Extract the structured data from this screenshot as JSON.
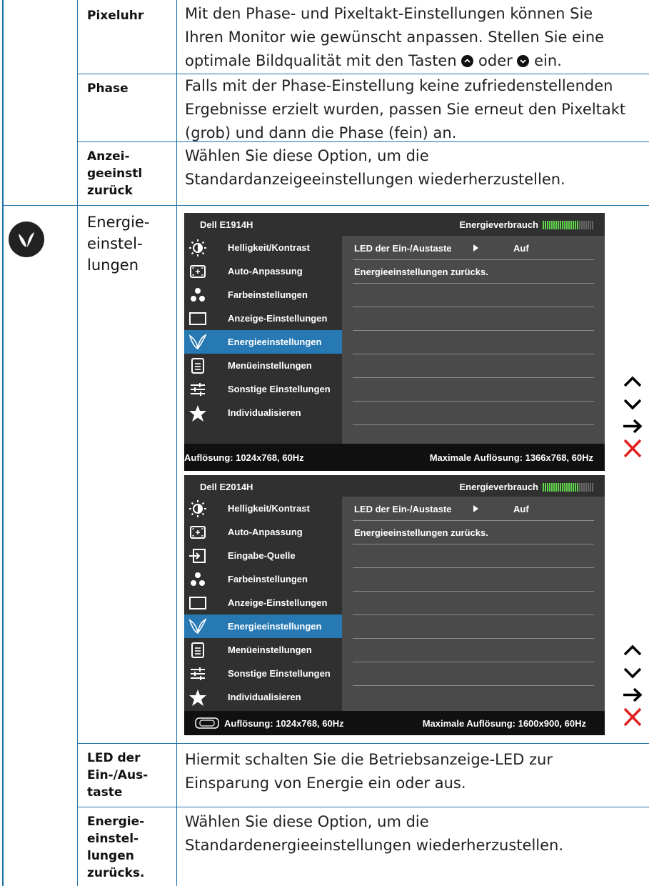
{
  "rows": {
    "pixeluhr": {
      "label": "Pixeluhr",
      "desc_line1": "Mit den Phase- und Pixeltakt-Einstellungen können Sie",
      "desc_line2": "Ihren Monitor wie gewünscht anpassen. Stellen Sie eine",
      "desc_line3a": "optimale Bildqualität mit den Tasten",
      "desc_line3b": "oder",
      "desc_line3c": "ein."
    },
    "phase": {
      "label": "Phase",
      "desc_line1": "Falls mit der Phase-Einstellung keine zufriedenstellenden",
      "desc_line2": "Ergebnisse erzielt wurden, passen Sie erneut den Pixeltakt",
      "desc_line3": "(grob) und dann die Phase (fein) an."
    },
    "anzeige_reset": {
      "label_line1": "Anzei-",
      "label_line2": "geeinstl",
      "label_line3": "zurück",
      "desc_line1": "Wählen Sie diese Option, um die",
      "desc_line2": "Standardanzeigeeinstellungen wiederherzustellen."
    },
    "energie": {
      "label_line1": "Energie-",
      "label_line2": "einstel-",
      "label_line3": "lungen"
    },
    "led": {
      "label_line1": "LED der",
      "label_line2": "Ein-/Aus-",
      "label_line3": "taste",
      "desc_line1": "Hiermit schalten Sie die Betriebsanzeige-LED zur",
      "desc_line2": "Einsparung von Energie ein oder aus."
    },
    "energie_reset": {
      "label_line1": "Energie-",
      "label_line2": "einstel-",
      "label_line3": "lungen",
      "label_line4": "zurücks.",
      "desc_line1": "Wählen Sie diese Option, um die",
      "desc_line2": "Standardenergieeinstellungen wiederherzustellen."
    }
  },
  "osd1": {
    "model": "Dell E1914H",
    "energy_label": "Energieverbrauch",
    "energy_level": 0.7,
    "menu": [
      "Helligkeit/Kontrast",
      "Auto-Anpassung",
      "Farbeinstellungen",
      "Anzeige-Einstellungen",
      "Energieeinstellungen",
      "Menüeinstellungen",
      "Sonstige Einstellungen",
      "Individualisieren"
    ],
    "menu_icons": [
      "brightness-icon",
      "auto-adjust-icon",
      "color-icon",
      "display-icon",
      "leaf-icon",
      "menu-icon",
      "settings-icon",
      "star-icon"
    ],
    "selected": 4,
    "option1": "LED der Ein-/Austaste",
    "option1_value": "Auf",
    "option2": "Energieeinstellungen zurücks.",
    "resolution": "Auflösung: 1024x768, 60Hz",
    "max_resolution": "Maximale Auflösung: 1366x768, 60Hz"
  },
  "osd2": {
    "model": "Dell E2014H",
    "energy_label": "Energieverbrauch",
    "energy_level": 0.7,
    "menu": [
      "Helligkeit/Kontrast",
      "Auto-Anpassung",
      "Eingabe-Quelle",
      "Farbeinstellungen",
      "Anzeige-Einstellungen",
      "Energieeinstellungen",
      "Menüeinstellungen",
      "Sonstige Einstellungen",
      "Individualisieren"
    ],
    "menu_icons": [
      "brightness-icon",
      "auto-adjust-icon",
      "input-icon",
      "color-icon",
      "display-icon",
      "leaf-icon",
      "menu-icon",
      "settings-icon",
      "star-icon"
    ],
    "selected": 5,
    "option1": "LED der Ein-/Austaste",
    "option1_value": "Auf",
    "option2": "Energieeinstellungen zurücks.",
    "resolution": "Auflösung: 1024x768, 60Hz",
    "max_resolution": "Maximale Auflösung: 1600x900, 60Hz"
  },
  "nav_buttons": [
    "up-arrow-icon",
    "down-arrow-icon",
    "right-arrow-icon",
    "close-icon"
  ],
  "colors": {
    "accent": "#2779b3",
    "line": "#1f6fa8",
    "close": "#e02020",
    "energy_on": "#5fd14a"
  }
}
